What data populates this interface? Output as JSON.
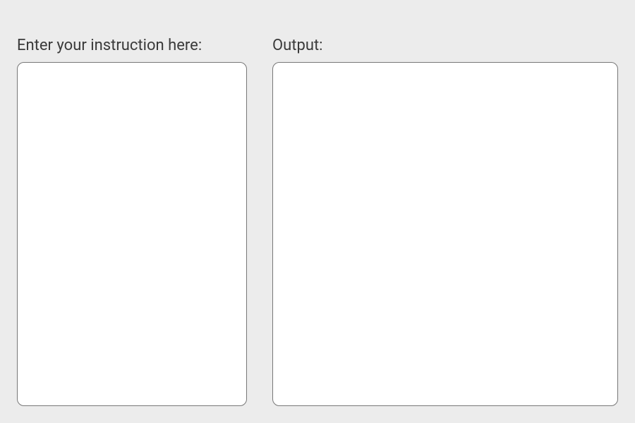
{
  "input": {
    "label": "Enter your instruction here:",
    "value": ""
  },
  "output": {
    "label": "Output:",
    "value": ""
  }
}
